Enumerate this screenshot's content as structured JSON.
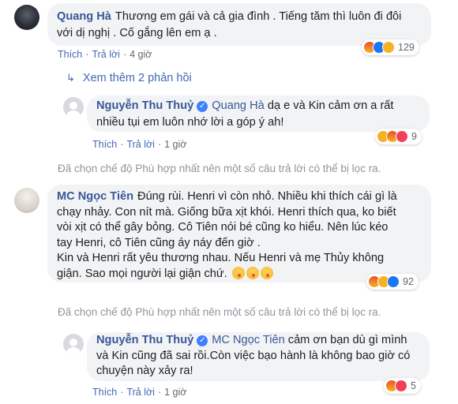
{
  "comments": [
    {
      "author": "Quang Hà",
      "text_line1": "Thương em gái và cả gia đình . Tiếng tăm thì luôn đi đôi",
      "text_line2": "với dị nghị . Cố gắng lên em ạ .",
      "like_label": "Thích",
      "reply_label": "Trả lời",
      "time": "4 giờ",
      "reaction_count": "129",
      "reactions": [
        "angry-icon",
        "like-icon",
        "haha-icon"
      ]
    },
    {
      "author": "Nguyễn Thu Thuỷ",
      "mention": "Quang Hà",
      "text_line1": "dạ e và Kin cảm ơn a rất",
      "text_line2": "nhiều tụi em luôn nhớ lời a góp ý ah!",
      "like_label": "Thích",
      "reply_label": "Trả lời",
      "time": "1 giờ",
      "reaction_count": "9",
      "reactions": [
        "haha-icon",
        "angry-icon",
        "love-icon"
      ]
    },
    {
      "author": "MC Ngọc Tiên",
      "text_line1": "Đúng rùi. Henri vì còn nhỏ. Nhiều khi thích cái gì là",
      "text_line2": "chạy nhảy. Con nít mà. Giống bữa xịt khói. Henri thích qua, ko biết",
      "text_line3": "vòi xịt có thể gây bỏng. Cô Tiên nói bé cũng ko hiểu. Nên lúc kéo",
      "text_line4": "tay Henri, cô Tiên cũng áy náy đến giờ .",
      "text_line5": "Kin và Henri rất yêu thương nhau. Nếu Henri và mẹ Thủy không",
      "text_line6": "giận. Sao mọi người lại giận chứ.",
      "reaction_count": "92",
      "reactions": [
        "angry-icon",
        "haha-icon",
        "like-icon"
      ]
    },
    {
      "author": "Nguyễn Thu Thuỷ",
      "mention": "MC Ngọc Tiên",
      "text_line1": "cảm ơn bạn dù gì mình",
      "text_line2": "và Kin cũng đã sai rồi.Còn việc bạo hành là không bao giờ có",
      "text_line3": "chuyện này xảy ra!",
      "like_label": "Thích",
      "reply_label": "Trả lời",
      "time": "1 giờ",
      "reaction_count": "5",
      "reactions": [
        "angry-icon",
        "love-icon"
      ]
    }
  ],
  "more_replies_label": "Xem thêm 2 phản hồi",
  "filter_notice": "Đã chọn chế độ Phù hợp nhất nên một số câu trả lời có thể bị lọc ra.",
  "colors": {
    "link": "#385898",
    "action": "#4267b2",
    "bubble": "#f2f3f5",
    "muted": "#90949c"
  }
}
